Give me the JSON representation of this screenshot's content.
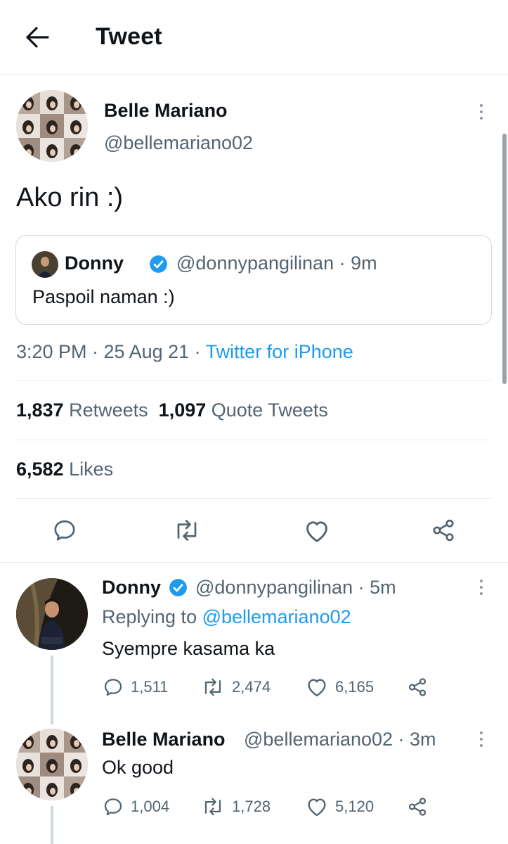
{
  "header": {
    "title": "Tweet"
  },
  "main_tweet": {
    "author_name": "Belle Mariano",
    "author_handle": "@bellemariano02",
    "text": "Ako rin :)",
    "quote": {
      "author_name": "Donny",
      "author_handle": "@donnypangilinan · 9m",
      "text": "Paspoil naman :)"
    },
    "time": "3:20 PM · 25 Aug 21 · ",
    "source": "Twitter for iPhone",
    "retweets_count": "1,837",
    "retweets_label": "Retweets",
    "quotes_count": "1,097",
    "quotes_label": "Quote Tweets",
    "likes_count": "6,582",
    "likes_label": "Likes"
  },
  "replies": [
    {
      "author_name": "Donny",
      "author_handle": "@donnypangilinan · 5m",
      "replying_prefix": "Replying to ",
      "replying_to": "@bellemariano02",
      "text": "Syempre kasama ka",
      "reply_count": "1,511",
      "retweet_count": "2,474",
      "like_count": "6,165"
    },
    {
      "author_name": "Belle Mariano",
      "author_handle": "@bellemariano02 · 3m",
      "text": "Ok good",
      "reply_count": "1,004",
      "retweet_count": "1,728",
      "like_count": "5,120"
    }
  ],
  "colors": {
    "link": "#1d9bf0",
    "secondary_text": "#536471",
    "divider": "#e7ecf0",
    "verified": "#1d9bf0"
  }
}
